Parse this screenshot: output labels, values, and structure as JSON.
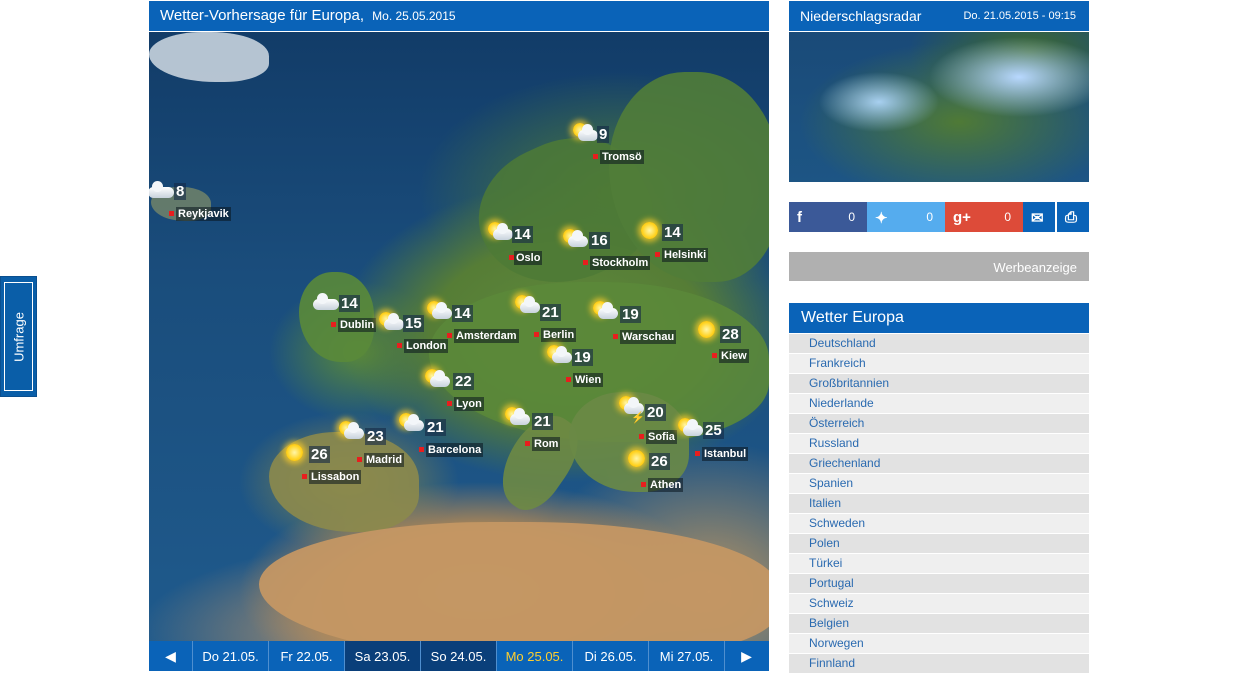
{
  "sidebar_tab": {
    "label": "Umfrage"
  },
  "map_panel": {
    "title": "Wetter-Vorhersage für Europa,",
    "date": "Mo. 25.05.2015",
    "cities": [
      {
        "name": "Tromsö",
        "temp": "9",
        "icon": "sun-cloud-icon"
      },
      {
        "name": "Reykjavik",
        "temp": "8",
        "icon": "cloud-icon"
      },
      {
        "name": "Oslo",
        "temp": "14",
        "icon": "sun-cloud-icon"
      },
      {
        "name": "Stockholm",
        "temp": "16",
        "icon": "sun-cloud-icon"
      },
      {
        "name": "Helsinki",
        "temp": "14",
        "icon": "sun-icon"
      },
      {
        "name": "Dublin",
        "temp": "14",
        "icon": "cloud-icon"
      },
      {
        "name": "London",
        "temp": "15",
        "icon": "sun-cloud-icon"
      },
      {
        "name": "Amsterdam",
        "temp": "14",
        "icon": "sun-cloud-icon"
      },
      {
        "name": "Berlin",
        "temp": "21",
        "icon": "sun-cloud-icon"
      },
      {
        "name": "Warschau",
        "temp": "19",
        "icon": "sun-cloud-icon"
      },
      {
        "name": "Kiew",
        "temp": "28",
        "icon": "sun-icon"
      },
      {
        "name": "Wien",
        "temp": "19",
        "icon": "sun-cloud-icon"
      },
      {
        "name": "Lyon",
        "temp": "22",
        "icon": "sun-cloud-icon"
      },
      {
        "name": "Madrid",
        "temp": "23",
        "icon": "sun-cloud-icon"
      },
      {
        "name": "Barcelona",
        "temp": "21",
        "icon": "sun-cloud-icon"
      },
      {
        "name": "Rom",
        "temp": "21",
        "icon": "sun-cloud-icon"
      },
      {
        "name": "Sofia",
        "temp": "20",
        "icon": "thunderstorm-icon"
      },
      {
        "name": "Istanbul",
        "temp": "25",
        "icon": "sun-cloud-icon"
      },
      {
        "name": "Lissabon",
        "temp": "26",
        "icon": "sun-icon"
      },
      {
        "name": "Athen",
        "temp": "26",
        "icon": "sun-icon"
      }
    ]
  },
  "day_bar": {
    "prev_icon": "arrow-left-icon",
    "next_icon": "arrow-right-icon",
    "days": [
      {
        "label": "Do 21.05."
      },
      {
        "label": "Fr 22.05."
      },
      {
        "label": "Sa 23.05."
      },
      {
        "label": "So 24.05."
      },
      {
        "label": "Mo 25.05."
      },
      {
        "label": "Di 26.05."
      },
      {
        "label": "Mi 27.05."
      }
    ],
    "active_day": "Mo 25.05."
  },
  "radar": {
    "title": "Niederschlagsradar",
    "time": "Do. 21.05.2015 - 09:15"
  },
  "share": {
    "facebook_count": "0",
    "twitter_count": "0",
    "googleplus_count": "0",
    "icons": [
      "facebook-icon",
      "twitter-icon",
      "google-plus-icon",
      "mail-icon",
      "print-icon"
    ]
  },
  "ad": {
    "label": "Werbeanzeige"
  },
  "regions": {
    "title": "Wetter Europa",
    "items": [
      "Deutschland",
      "Frankreich",
      "Großbritannien",
      "Niederlande",
      "Österreich",
      "Russland",
      "Griechenland",
      "Spanien",
      "Italien",
      "Schweden",
      "Polen",
      "Türkei",
      "Portugal",
      "Schweiz",
      "Belgien",
      "Norwegen",
      "Finnland"
    ]
  },
  "colors": {
    "header_blue": "#0a63b8",
    "active_day": "#ffcf2e",
    "city_dot": "#e81e1e",
    "link": "#2a6ab0"
  }
}
